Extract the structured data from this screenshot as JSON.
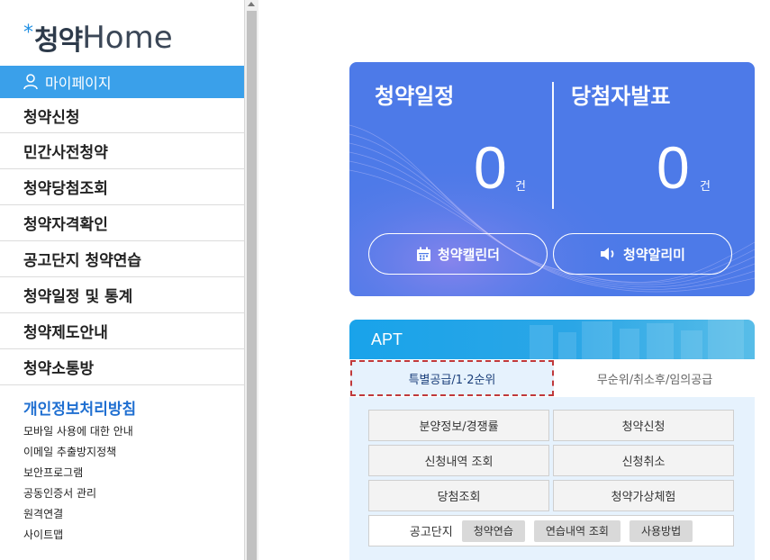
{
  "logo": {
    "star": "*",
    "korean": "청약",
    "english": "Home"
  },
  "sidebar": {
    "active_item": "마이페이지",
    "items": [
      "청약신청",
      "민간사전청약",
      "청약당첨조회",
      "청약자격확인",
      "공고단지 청약연습",
      "청약일정 및 통계",
      "청약제도안내",
      "청약소통방"
    ],
    "privacy_title": "개인정보처리방침",
    "links": [
      "모바일 사용에 대한 안내",
      "이메일 추출방지정책",
      "보안프로그램",
      "공동인증서 관리",
      "원격연결",
      "사이트맵"
    ]
  },
  "schedule": {
    "left_title": "청약일정",
    "right_title": "당첨자발표",
    "left_count": "0",
    "right_count": "0",
    "unit": "건",
    "calendar_button": "청약캘린더",
    "alarm_button": "청약알리미"
  },
  "apt": {
    "title": "APT",
    "tabs": [
      "특별공급/1·2순위",
      "무순위/취소후/임의공급"
    ],
    "buttons": [
      [
        "분양정보/경쟁률",
        "청약신청"
      ],
      [
        "신청내역 조회",
        "신청취소"
      ],
      [
        "당첨조회",
        "청약가상체험"
      ]
    ],
    "complex_label": "공고단지",
    "chips": [
      "청약연습",
      "연습내역 조회",
      "사용방법"
    ]
  },
  "colors": {
    "primary": "#4d7ae8",
    "sidebar_active": "#3aa0ea",
    "apt_header": "#19a3ea",
    "tab_outline": "#c0393b"
  }
}
